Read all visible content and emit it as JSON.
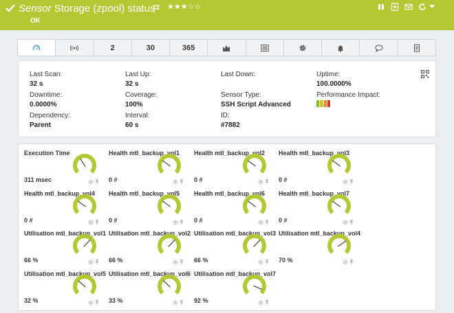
{
  "header": {
    "title_em": "Sensor",
    "title_rest": " Storage (zpool) status",
    "stars": "★★★☆☆",
    "status": "OK",
    "icons": [
      "pause-icon",
      "add-icon",
      "email-icon",
      "refresh-icon",
      "chevron-down-icon"
    ]
  },
  "tabs": [
    {
      "name": "tab-overview",
      "label": "",
      "icon": "gauge-icon"
    },
    {
      "name": "tab-live",
      "label": "",
      "icon": "live-icon"
    },
    {
      "name": "tab-2days",
      "label": "2"
    },
    {
      "name": "tab-30days",
      "label": "30"
    },
    {
      "name": "tab-365days",
      "label": "365"
    },
    {
      "name": "tab-historic",
      "label": "",
      "icon": "chart-icon"
    },
    {
      "name": "tab-log",
      "label": "",
      "icon": "log-icon"
    },
    {
      "name": "tab-settings",
      "label": "",
      "icon": "gear-icon"
    },
    {
      "name": "tab-notifications",
      "label": "",
      "icon": "bell-icon"
    },
    {
      "name": "tab-comments",
      "label": "",
      "icon": "comment-icon"
    },
    {
      "name": "tab-history",
      "label": "",
      "icon": "history-icon"
    }
  ],
  "info": {
    "last_scan": {
      "k": "Last Scan:",
      "v": "32 s"
    },
    "last_up": {
      "k": "Last Up:",
      "v": "32 s"
    },
    "last_down": {
      "k": "Last Down:",
      "v": ""
    },
    "uptime": {
      "k": "Uptime:",
      "v": "100.0000%"
    },
    "downtime": {
      "k": "Downtime:",
      "v": "0.0000%"
    },
    "coverage": {
      "k": "Coverage:",
      "v": "100%"
    },
    "sensor_type": {
      "k": "Sensor Type:",
      "v": "SSH Script Advanced"
    },
    "perf_impact": {
      "k": "Performance Impact:",
      "colors": [
        "#8ab82e",
        "#d6c22a",
        "#e48a2a",
        "#d4362a"
      ]
    },
    "dependency": {
      "k": "Dependency:",
      "v": "Parent"
    },
    "interval": {
      "k": "Interval:",
      "v": "60 s"
    },
    "id": {
      "k": "ID:",
      "v": "#7882"
    }
  },
  "gauges": [
    {
      "label": "Execution Time",
      "value": "311 msec",
      "level": 0.38
    },
    {
      "label": "Health mtl_backup_vol1",
      "value": "0 #",
      "level": 0.3
    },
    {
      "label": "Health mtl_backup_vol2",
      "value": "0 #",
      "level": 0.3
    },
    {
      "label": "Health mtl_backup_vol3",
      "value": "0 #",
      "level": 0.3
    },
    {
      "label": "Health mtl_backup_vol4",
      "value": "0 #",
      "level": 0.3
    },
    {
      "label": "Health mtl_backup_vol5",
      "value": "0 #",
      "level": 0.3
    },
    {
      "label": "Health mtl_backup_vol6",
      "value": "0 #",
      "level": 0.3
    },
    {
      "label": "Health mtl_backup_vol7",
      "value": "0 #",
      "level": 0.3
    },
    {
      "label": "Utilisation mtl_backup_vol1",
      "value": "66 %",
      "level": 0.66
    },
    {
      "label": "Utilisation mtl_backup_vol2",
      "value": "66 %",
      "level": 0.66
    },
    {
      "label": "Utilisation mtl_backup_vol3",
      "value": "66 %",
      "level": 0.66
    },
    {
      "label": "Utilisation mtl_backup_vol4",
      "value": "70 %",
      "level": 0.7
    },
    {
      "label": "Utilisation mtl_backup_vol5",
      "value": "32 %",
      "level": 0.32
    },
    {
      "label": "Utilisation mtl_backup_vol6",
      "value": "33 %",
      "level": 0.33
    },
    {
      "label": "Utilisation mtl_backup_vol7",
      "value": "92 %",
      "level": 0.92
    }
  ],
  "colors": {
    "accent": "#b4c834",
    "gauge": "#b4c834",
    "gauge_track": "#ffffff"
  }
}
